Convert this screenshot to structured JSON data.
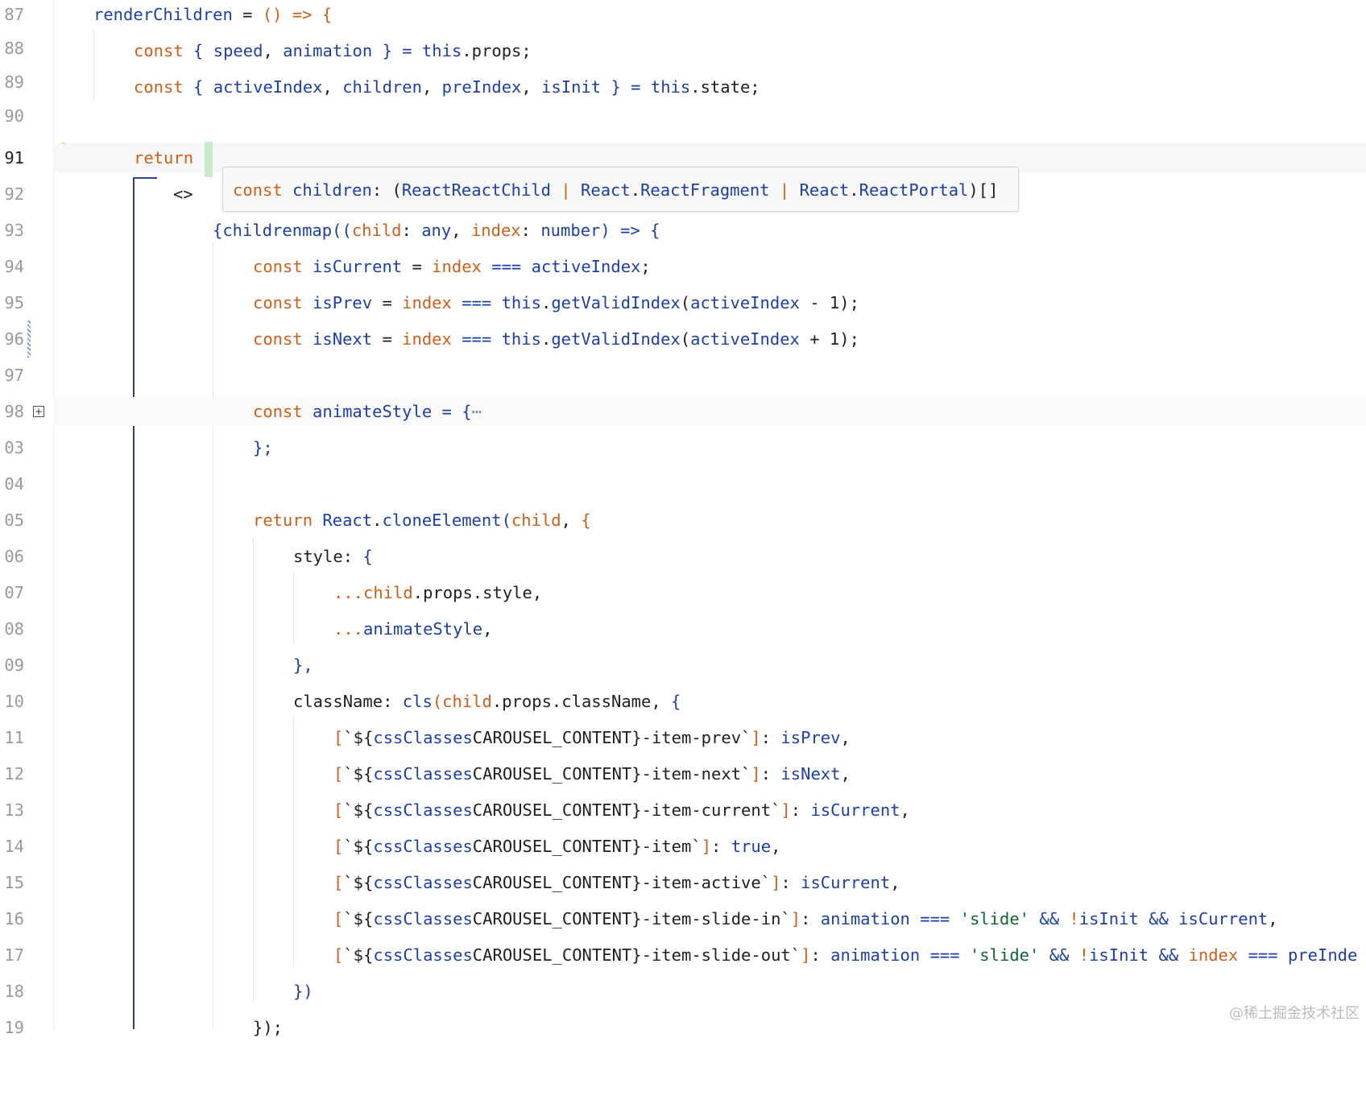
{
  "editor": {
    "line_numbers": [
      "87",
      "88",
      "89",
      "90",
      "91",
      "92",
      "93",
      "94",
      "95",
      "96",
      "97",
      "98",
      "03",
      "04",
      "05",
      "06",
      "07",
      "08",
      "09",
      "10",
      "11",
      "12",
      "13",
      "14",
      "15",
      "16",
      "17",
      "18",
      "19"
    ],
    "active_line_number": "91",
    "hint_icon": "lightbulb-icon",
    "fold_icon": "fold-expand-icon",
    "fold_symbol": "+"
  },
  "code": {
    "l87": {
      "a": "renderChildren",
      "b": " = ",
      "c": "() => {"
    },
    "l88": {
      "a": "const",
      "b": " { ",
      "c": "speed",
      ",": ", ",
      "d": "animation",
      "e": " } = ",
      "f": "this",
      "g": ".props;"
    },
    "l89": {
      "a": "const",
      "b": " { ",
      "c": "activeIndex",
      ",": ", ",
      "d": "children",
      "e": ", ",
      "f": "preIndex",
      "g": ", ",
      "h": "isInit",
      "i": " } = ",
      "j": "this",
      "k": ".state;"
    },
    "l91": {
      "a": "return",
      "b": " ("
    },
    "l92": {
      "a": "<>"
    },
    "l93": {
      "a": "{",
      "b": "children",
      ".": ".",
      "c": "map",
      "d": "((",
      "e": "child",
      ":": ": ",
      "f": "any",
      ",": ", ",
      "g": "index",
      "h": ": ",
      "i": "number",
      "j": ") => {"
    },
    "l94": {
      "a": "const",
      "b": " isCurrent ",
      "c": "=",
      "d": " index",
      "e": " === ",
      "f": "activeIndex",
      "g": ";"
    },
    "l95": {
      "a": "const",
      "b": " isPrev ",
      "c": "=",
      "d": " index",
      "e": " === ",
      "f": "this",
      "g": ".",
      "h": "getValidIndex",
      "i": "(",
      "j": "activeIndex",
      "k": " - 1);"
    },
    "l96": {
      "a": "const",
      "b": " isNext ",
      "c": "=",
      "d": " index",
      "e": " === ",
      "f": "this",
      "g": ".",
      "h": "getValidIndex",
      "i": "(",
      "j": "activeIndex",
      "k": " + 1);"
    },
    "l98": {
      "a": "const",
      "b": " animateStyle ",
      "c": "= {",
      "d": "⋯"
    },
    "l103": {
      "a": "};"
    },
    "l105": {
      "a": "return",
      "b": " React",
      "c": ".",
      "d": "cloneElement",
      "e": "(",
      "f": "child",
      ",": ", ",
      "g": "{"
    },
    "l106": {
      "a": "style",
      ":": ": ",
      "b": "{"
    },
    "l107": {
      "a": "...",
      "b": "child",
      "c": ".props.style,"
    },
    "l108": {
      "a": "...",
      "b": "animateStyle",
      "c": ","
    },
    "l109": {
      "a": "},"
    },
    "l110": {
      "a": "className",
      ":": ": ",
      "b": "cls",
      "c": "(",
      "d": "child",
      "e": ".props.className, ",
      "f": "{"
    },
    "l111": {
      "a": "[",
      "b": "`${",
      "c": "cssClasses",
      ".": ".",
      "d": "CAROUSEL_CONTENT",
      "e": "}-item-prev`",
      "f": "]",
      ":": ": ",
      "g": "isPrev",
      "h": ","
    },
    "l112": {
      "a": "[",
      "b": "`${",
      "c": "cssClasses",
      ".": ".",
      "d": "CAROUSEL_CONTENT",
      "e": "}-item-next`",
      "f": "]",
      ":": ": ",
      "g": "isNext",
      "h": ","
    },
    "l113": {
      "a": "[",
      "b": "`${",
      "c": "cssClasses",
      ".": ".",
      "d": "CAROUSEL_CONTENT",
      "e": "}-item-current`",
      "f": "]",
      ":": ": ",
      "g": "isCurrent",
      "h": ","
    },
    "l114": {
      "a": "[",
      "b": "`${",
      "c": "cssClasses",
      ".": ".",
      "d": "CAROUSEL_CONTENT",
      "e": "}-item`",
      "f": "]",
      ":": ": ",
      "g": "true",
      "h": ","
    },
    "l115": {
      "a": "[",
      "b": "`${",
      "c": "cssClasses",
      ".": ".",
      "d": "CAROUSEL_CONTENT",
      "e": "}-item-active`",
      "f": "]",
      ":": ": ",
      "g": "isCurrent",
      "h": ","
    },
    "l116": {
      "a": "[",
      "b": "`${",
      "c": "cssClasses",
      ".": ".",
      "d": "CAROUSEL_CONTENT",
      "e": "}-item-slide-in`",
      "f": "]",
      ":": ": ",
      "g": "animation",
      "h": " === ",
      "i": "'slide'",
      "j": " && ",
      "k": "!",
      "l": "isInit",
      "m": " && ",
      "n": "isCurrent",
      "o": ","
    },
    "l117": {
      "a": "[",
      "b": "`${",
      "c": "cssClasses",
      ".": ".",
      "d": "CAROUSEL_CONTENT",
      "e": "}-item-slide-out`",
      "f": "]",
      ":": ": ",
      "g": "animation",
      "h": " === ",
      "i": "'slide'",
      "j": " && ",
      "k": "!",
      "l": "isInit",
      "m": " && ",
      "n": "index",
      "o": " === ",
      "p": "preInde"
    },
    "l118": {
      "a": "})"
    },
    "l119": {
      "a": "});"
    }
  },
  "tooltip": {
    "a": "const",
    "b": " children",
    ":": ": ",
    "c": "(",
    "d": "React",
    ".": ".",
    "e": "ReactChild",
    "f": " | ",
    "g": "React",
    "h": ".",
    "i": "ReactFragment",
    "j": " | ",
    "k": "React",
    "l": ".",
    "m": "ReactPortal",
    "n": ")[]"
  },
  "watermark": "@稀土掘金技术社区",
  "colors": {
    "keyword": "#cc5f1a",
    "identifier": "#1d3fa5",
    "string": "#116633",
    "text": "#1f1f1f",
    "block_bar": "#2d3e8a"
  }
}
